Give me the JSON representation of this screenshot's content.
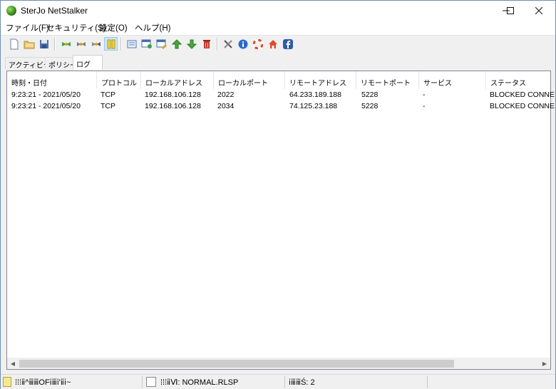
{
  "window": {
    "title": "SterJo NetStalker"
  },
  "menu": {
    "items": [
      "ファイル(F)",
      "セキュリティ(S)",
      "設定(O)",
      "ヘルプ(H)"
    ]
  },
  "toolbar": {
    "icons": [
      "new-icon",
      "open-icon",
      "save-icon",
      "connect-icon",
      "disconnect-icon",
      "refresh-icon",
      "pause-icon",
      "list-icon",
      "add-window-icon",
      "edit-window-icon",
      "up-arrow-icon",
      "down-arrow-icon",
      "delete-icon",
      "tools-icon",
      "info-icon",
      "help-lifebuoy-icon",
      "home-icon",
      "facebook-icon"
    ]
  },
  "tabs": [
    "アクティビティ",
    "ポリシー",
    "ログ"
  ],
  "log": {
    "columns": [
      "時刻・日付",
      "プロトコル",
      "ローカルアドレス",
      "ローカルポート",
      "リモートアドレス",
      "リモートポート",
      "サービス",
      "ステータス"
    ],
    "rows": [
      [
        "9:23:21 - 2021/05/20",
        "TCP",
        "192.168.106.128",
        "2022",
        "64.233.189.188",
        "5228",
        "-",
        "BLOCKED CONNE"
      ],
      [
        "9:23:21 - 2021/05/20",
        "TCP",
        "192.168.106.128",
        "2034",
        "74.125.23.188",
        "5228",
        "-",
        "BLOCKED CONNE"
      ]
    ]
  },
  "status": {
    "panel1": "⁞⁞⁞ⅱ^ⅲⅲOFⅰⅲⅰ'ⅱⅰ~",
    "panel2": "⁞⁞⁞ⅱⅥ: NORMAL.RLSP",
    "panel3": "ⅰⅲⅲŚ: 2"
  }
}
